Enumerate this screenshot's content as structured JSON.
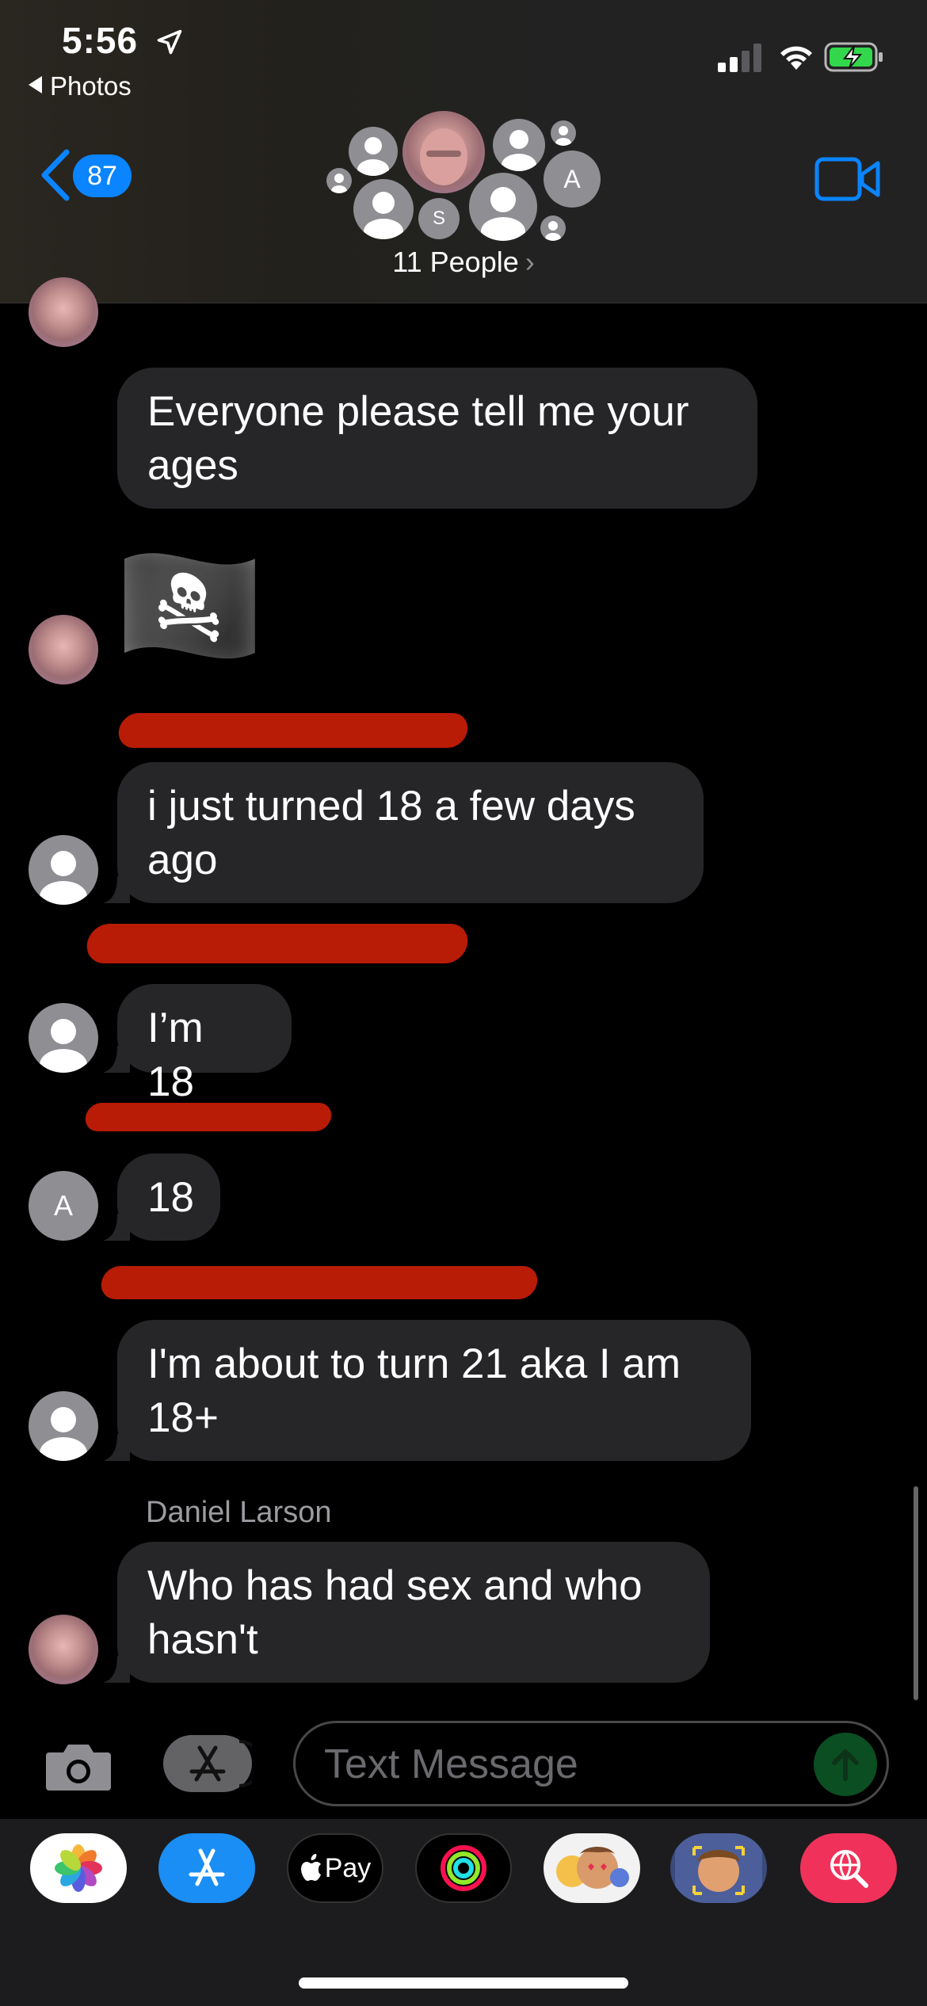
{
  "status_bar": {
    "time": "5:56",
    "back_app": "Photos"
  },
  "header": {
    "back_count": "87",
    "group_title": "11 People",
    "avatar_initial_a": "A",
    "avatar_initial_s": "S"
  },
  "messages": [
    {
      "text": "Everyone please tell me your ages"
    },
    {
      "text": "i just turned 18 a few days ago"
    },
    {
      "text": "I’m 18"
    },
    {
      "text": "18"
    },
    {
      "text": "I'm about to turn 21 aka I am 18+"
    },
    {
      "text": "Who has had sex and who hasn't"
    }
  ],
  "avatars": {
    "a_initial": "A"
  },
  "sender_label": "Daniel Larson",
  "emoji_message": "🏴‍☠️",
  "input": {
    "placeholder": "Text Message"
  },
  "app_drawer": {
    "apple_pay_label": "Pay"
  },
  "colors": {
    "accent": "#0a84ff",
    "bubble": "#262629",
    "redaction": "#b81b06",
    "send_disabled": "#0b4e22"
  }
}
